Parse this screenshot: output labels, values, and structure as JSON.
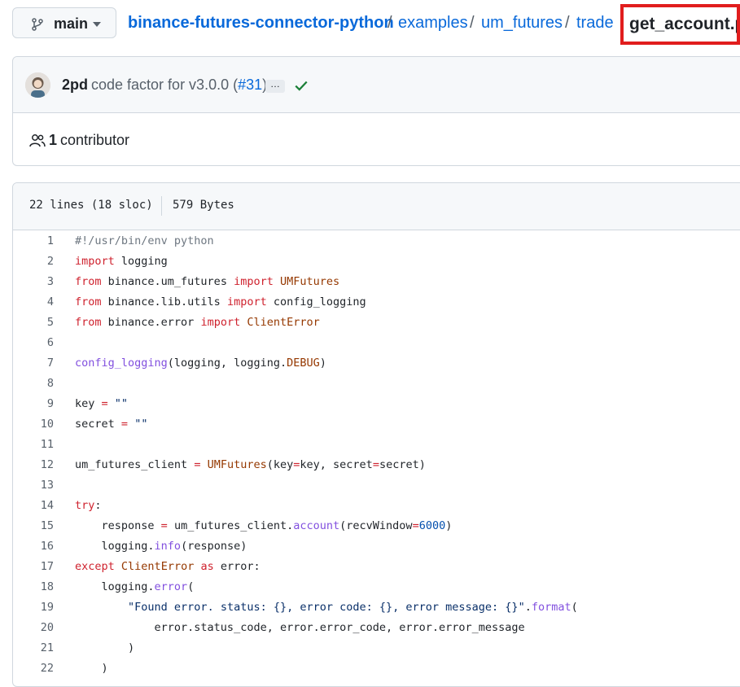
{
  "branch": {
    "label": "main",
    "icon": "git-branch-icon"
  },
  "breadcrumb": {
    "repo": "binance-futures-connector-python",
    "parts": [
      "examples",
      "um_futures",
      "trade"
    ],
    "separator": "/",
    "current": "get_account.py"
  },
  "commit": {
    "author": "2pd",
    "message": "code factor for v3.0.0 (",
    "pr": "#31",
    "message_end": ")",
    "ellipsis": "…",
    "status": "success"
  },
  "contributors": {
    "count": "1",
    "label": "contributor"
  },
  "file": {
    "lines_info": "22 lines (18 sloc)",
    "size": "579 Bytes"
  },
  "code_lines": [
    {
      "n": "1",
      "tokens": [
        [
          "cm",
          "#!/usr/bin/env python"
        ]
      ]
    },
    {
      "n": "2",
      "tokens": [
        [
          "kw",
          "import"
        ],
        [
          "",
          " logging"
        ]
      ]
    },
    {
      "n": "3",
      "tokens": [
        [
          "kw",
          "from"
        ],
        [
          "",
          " binance.um_futures "
        ],
        [
          "kw",
          "import"
        ],
        [
          "",
          " "
        ],
        [
          "cls",
          "UMFutures"
        ]
      ]
    },
    {
      "n": "4",
      "tokens": [
        [
          "kw",
          "from"
        ],
        [
          "",
          " binance.lib.utils "
        ],
        [
          "kw",
          "import"
        ],
        [
          "",
          " config_logging"
        ]
      ]
    },
    {
      "n": "5",
      "tokens": [
        [
          "kw",
          "from"
        ],
        [
          "",
          " binance.error "
        ],
        [
          "kw",
          "import"
        ],
        [
          "",
          " "
        ],
        [
          "cls",
          "ClientError"
        ]
      ]
    },
    {
      "n": "6",
      "tokens": []
    },
    {
      "n": "7",
      "tokens": [
        [
          "fn",
          "config_logging"
        ],
        [
          "",
          "(logging, logging."
        ],
        [
          "cls",
          "DEBUG"
        ],
        [
          "",
          ")"
        ]
      ]
    },
    {
      "n": "8",
      "tokens": []
    },
    {
      "n": "9",
      "tokens": [
        [
          "",
          "key "
        ],
        [
          "kw",
          "="
        ],
        [
          "",
          " "
        ],
        [
          "str",
          "\"\""
        ]
      ]
    },
    {
      "n": "10",
      "tokens": [
        [
          "",
          "secret "
        ],
        [
          "kw",
          "="
        ],
        [
          "",
          " "
        ],
        [
          "str",
          "\"\""
        ]
      ]
    },
    {
      "n": "11",
      "tokens": []
    },
    {
      "n": "12",
      "tokens": [
        [
          "",
          "um_futures_client "
        ],
        [
          "kw",
          "="
        ],
        [
          "",
          " "
        ],
        [
          "cls",
          "UMFutures"
        ],
        [
          "",
          "(key"
        ],
        [
          "kw",
          "="
        ],
        [
          "",
          "key, secret"
        ],
        [
          "kw",
          "="
        ],
        [
          "",
          "secret)"
        ]
      ]
    },
    {
      "n": "13",
      "tokens": []
    },
    {
      "n": "14",
      "tokens": [
        [
          "kw",
          "try"
        ],
        [
          "",
          ":"
        ]
      ]
    },
    {
      "n": "15",
      "tokens": [
        [
          "",
          "    response "
        ],
        [
          "kw",
          "="
        ],
        [
          "",
          " um_futures_client."
        ],
        [
          "fn",
          "account"
        ],
        [
          "",
          "(recvWindow"
        ],
        [
          "kw",
          "="
        ],
        [
          "num",
          "6000"
        ],
        [
          "",
          ")"
        ]
      ]
    },
    {
      "n": "16",
      "tokens": [
        [
          "",
          "    logging."
        ],
        [
          "fn",
          "info"
        ],
        [
          "",
          "(response)"
        ]
      ]
    },
    {
      "n": "17",
      "tokens": [
        [
          "kw",
          "except"
        ],
        [
          "",
          " "
        ],
        [
          "cls",
          "ClientError"
        ],
        [
          "",
          " "
        ],
        [
          "kw",
          "as"
        ],
        [
          "",
          " error:"
        ]
      ]
    },
    {
      "n": "18",
      "tokens": [
        [
          "",
          "    logging."
        ],
        [
          "fn",
          "error"
        ],
        [
          "",
          "("
        ]
      ]
    },
    {
      "n": "19",
      "tokens": [
        [
          "",
          "        "
        ],
        [
          "str",
          "\"Found error. status: {}, error code: {}, error message: {}\""
        ],
        [
          "",
          "."
        ],
        [
          "fn",
          "format"
        ],
        [
          "",
          "("
        ]
      ]
    },
    {
      "n": "20",
      "tokens": [
        [
          "",
          "            error.status_code, error.error_code, error.error_message"
        ]
      ]
    },
    {
      "n": "21",
      "tokens": [
        [
          "",
          "        )"
        ]
      ]
    },
    {
      "n": "22",
      "tokens": [
        [
          "",
          "    )"
        ]
      ]
    }
  ]
}
